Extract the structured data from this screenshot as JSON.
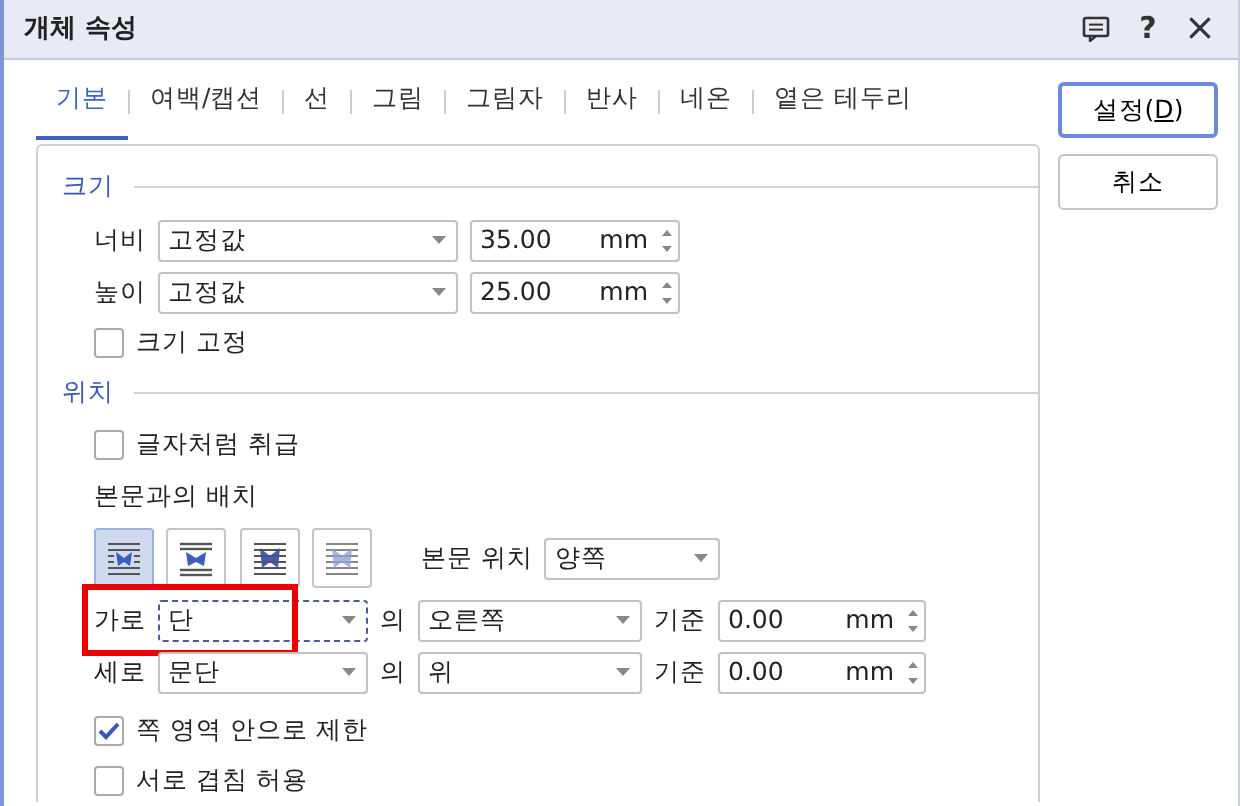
{
  "window": {
    "title": "개체 속성",
    "buttons": [
      {
        "kind": "memo"
      },
      {
        "kind": "help",
        "label": "?"
      },
      {
        "kind": "close",
        "label": "×"
      }
    ]
  },
  "tabs": [
    {
      "label": "기본",
      "selected": true
    },
    {
      "label": "여백/캡션",
      "selected": false
    },
    {
      "label": "선",
      "selected": false
    },
    {
      "label": "그림",
      "selected": false
    },
    {
      "label": "그림자",
      "selected": false
    },
    {
      "label": "반사",
      "selected": false
    },
    {
      "label": "네온",
      "selected": false
    },
    {
      "label": "옅은 테두리",
      "selected": false
    }
  ],
  "actions": [
    {
      "label_before": "설정(",
      "mnemonic": "D",
      "label_after": ")",
      "default": true
    },
    {
      "label_before": "취소",
      "default": false
    }
  ],
  "size": {
    "title": "크기",
    "rows": [
      {
        "label": "너비",
        "mode": "고정값",
        "value": "35.00",
        "unit": "mm"
      },
      {
        "label": "높이",
        "mode": "고정값",
        "value": "25.00",
        "unit": "mm"
      }
    ],
    "lock": {
      "label": "크기 고정",
      "checked": false
    }
  },
  "position": {
    "title": "위치",
    "treat_as_char": {
      "label": "글자처럼 취급",
      "checked": false
    },
    "wrap_label": "본문과의 배치",
    "wrap_options": [
      {
        "kind": "square",
        "selected": true
      },
      {
        "kind": "topbottom",
        "selected": false
      },
      {
        "kind": "behind",
        "selected": false
      },
      {
        "kind": "front",
        "selected": false
      }
    ],
    "text_side": {
      "label": "본문 위치",
      "value": "양쪽"
    },
    "rows": [
      {
        "label": "가로",
        "anchor": "단",
        "of": "의",
        "relation": "오른쪽",
        "base": "기준",
        "value": "0.00",
        "unit": "mm",
        "focused": true,
        "highlighted": true
      },
      {
        "label": "세로",
        "anchor": "문단",
        "of": "의",
        "relation": "위",
        "base": "기준",
        "value": "0.00",
        "unit": "mm",
        "focused": false,
        "highlighted": false
      }
    ],
    "options": [
      {
        "label": "쪽 영역 안으로 제한",
        "checked": true
      },
      {
        "label": "서로 겹침 허용",
        "checked": false
      }
    ]
  }
}
